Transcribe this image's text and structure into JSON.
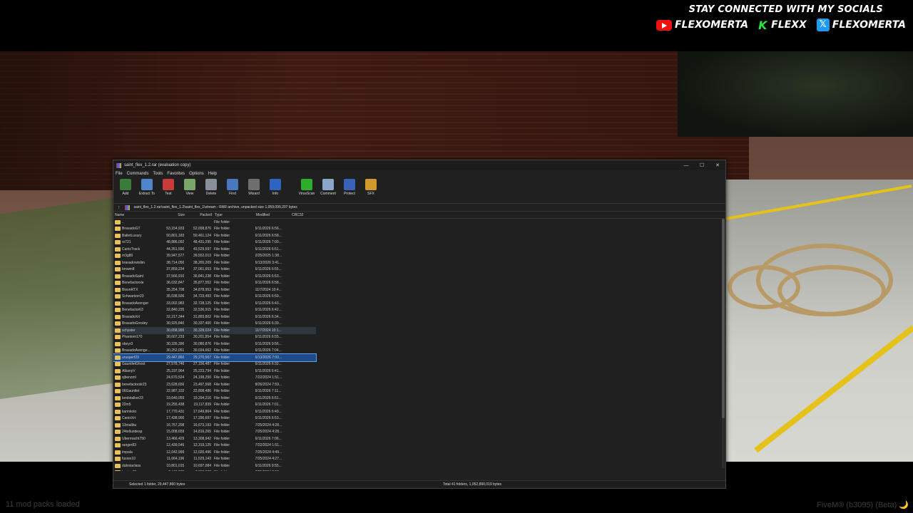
{
  "overlay": {
    "social_title": "STAY CONNECTED WITH MY SOCIALS",
    "socials": [
      {
        "icon": "youtube-icon",
        "label": "FLEXOMERTA"
      },
      {
        "icon": "kick-icon",
        "label": "FLEXX"
      },
      {
        "icon": "x-icon",
        "label": "FLEXOMERTA"
      }
    ]
  },
  "game": {
    "mods_loaded": "11 mod packs loaded",
    "fivem_version": "FiveM® (b3095) (Beta) 🌙"
  },
  "window": {
    "title": "saint_flex_1.2.rar (evaluation copy)",
    "minimize": "—",
    "maximize": "☐",
    "close": "✕",
    "menu": [
      "File",
      "Commands",
      "Tools",
      "Favorites",
      "Options",
      "Help"
    ],
    "toolbar": [
      {
        "label": "Add",
        "icon": "add-icon",
        "color": "#3a7a3a"
      },
      {
        "label": "Extract To",
        "icon": "extract-icon",
        "color": "#4f86c9"
      },
      {
        "label": "Test",
        "icon": "test-icon",
        "color": "#c93b3b"
      },
      {
        "label": "View",
        "icon": "view-icon",
        "color": "#7aa66a"
      },
      {
        "label": "Delete",
        "icon": "delete-icon",
        "color": "#8a8f99"
      },
      {
        "label": "Find",
        "icon": "find-icon",
        "color": "#4a78c0"
      },
      {
        "label": "Wizard",
        "icon": "wizard-icon",
        "color": "#6e6e6e"
      },
      {
        "label": "Info",
        "icon": "info-icon",
        "color": "#2f63c2"
      },
      {
        "label": "VirusScan",
        "icon": "virusscan-icon",
        "color": "#2cae2c"
      },
      {
        "label": "Comment",
        "icon": "comment-icon",
        "color": "#8aa6c8"
      },
      {
        "label": "Protect",
        "icon": "protect-icon",
        "color": "#3a62b8"
      },
      {
        "label": "SFX",
        "icon": "sfx-icon",
        "color": "#d09a2c"
      }
    ],
    "path": "saint_flex_1.2.rar\\saint_flex_1.2\\saint_flex_1\\stream - RAR archive, unpacked size 1,059,099,207 bytes",
    "columns": [
      "Name",
      "Size",
      "Packed",
      "Type",
      "Modified",
      "CRC32"
    ],
    "rows": [
      {
        "name": "..",
        "size": "",
        "packed": "",
        "type": "File folder",
        "modified": ""
      },
      {
        "name": "BravadoGT",
        "size": "53,154,933",
        "packed": "52,658,876",
        "type": "File folder",
        "modified": "6/11/2026 6:56..."
      },
      {
        "name": "BalletLuxury",
        "size": "50,801,183",
        "packed": "50,461,124",
        "type": "File folder",
        "modified": "6/11/2026 6:58..."
      },
      {
        "name": "rs721",
        "size": "48,886,092",
        "packed": "48,431,295",
        "type": "File folder",
        "modified": "6/11/2026 7:00..."
      },
      {
        "name": "CanisTrack",
        "size": "44,351,590",
        "packed": "43,529,597",
        "type": "File folder",
        "modified": "6/11/2026 6:51..."
      },
      {
        "name": "m3g80",
        "size": "39,947,577",
        "packed": "39,552,013",
        "type": "File folder",
        "modified": "2/25/2025 1:38..."
      },
      {
        "name": "bravadowtslim",
        "size": "38,714,050",
        "packed": "38,265,209",
        "type": "File folder",
        "modified": "6/13/2026 3:41..."
      },
      {
        "name": "bmwm8",
        "size": "37,859,234",
        "packed": "37,061,653",
        "type": "File folder",
        "modified": "6/11/2026 6:55..."
      },
      {
        "name": "BravadoSaint",
        "size": "37,566,910",
        "packed": "36,841,238",
        "type": "File folder",
        "modified": "6/11/2026 6:53..."
      },
      {
        "name": "Benefactorxle",
        "size": "36,032,847",
        "packed": "35,877,552",
        "type": "File folder",
        "modified": "6/11/2026 6:58..."
      },
      {
        "name": "BisonRTX",
        "size": "35,254,708",
        "packed": "34,878,953",
        "type": "File folder",
        "modified": "11/7/2024 10:4..."
      },
      {
        "name": "Schwartzer23",
        "size": "35,038,506",
        "packed": "34,723,493",
        "type": "File folder",
        "modified": "6/11/2026 6:59..."
      },
      {
        "name": "BravadoAvenger",
        "size": "33,002,983",
        "packed": "32,728,125",
        "type": "File folder",
        "modified": "6/11/2026 6:43..."
      },
      {
        "name": "Benefactor63",
        "size": "32,840,235",
        "packed": "32,536,915",
        "type": "File folder",
        "modified": "6/11/2026 6:42..."
      },
      {
        "name": "BravadoXrt",
        "size": "32,217,344",
        "packed": "31,893,802",
        "type": "File folder",
        "modified": "6/11/2026 6:34..."
      },
      {
        "name": "BravadoGresley",
        "size": "30,925,840",
        "packed": "30,337,400",
        "type": "File folder",
        "modified": "6/11/2026 6:39..."
      },
      {
        "name": "schyster",
        "size": "30,658,995",
        "packed": "30,328,024",
        "type": "File folder",
        "modified": "11/7/2024 10:1..."
      },
      {
        "name": "Phantom170",
        "size": "30,607,233",
        "packed": "30,201,854",
        "type": "File folder",
        "modified": "6/11/2026 6:55..."
      },
      {
        "name": "obeyr3",
        "size": "30,335,396",
        "packed": "30,080,876",
        "type": "File folder",
        "modified": "6/11/2026 9:56..."
      },
      {
        "name": "BravadoAvenge...",
        "size": "30,252,051",
        "packed": "30,034,662",
        "type": "File folder",
        "modified": "6/11/2026 7:04..."
      },
      {
        "name": "urusperf23",
        "size": "29,447,860",
        "packed": "29,270,907",
        "type": "File folder",
        "modified": "6/13/2026 7:00..."
      },
      {
        "name": "GauntletGhost",
        "size": "27,578,746",
        "packed": "27,156,487",
        "type": "File folder",
        "modified": "6/11/2026 6:32..."
      },
      {
        "name": "AlbanyV",
        "size": "25,197,964",
        "packed": "25,223,794",
        "type": "File folder",
        "modified": "6/11/2026 6:41..."
      },
      {
        "name": "sjbenzml",
        "size": "24,670,524",
        "packed": "24,199,250",
        "type": "File folder",
        "modified": "7/22/2024 1:51..."
      },
      {
        "name": "benefactorslr23",
        "size": "23,628,656",
        "packed": "23,497,568",
        "type": "File folder",
        "modified": "8/26/2024 7:59..."
      },
      {
        "name": "06Gauntlet",
        "size": "22,987,102",
        "packed": "22,808,486",
        "type": "File folder",
        "modified": "6/11/2026 7:11..."
      },
      {
        "name": "landstalker23",
        "size": "19,640,059",
        "packed": "19,294,216",
        "type": "File folder",
        "modified": "6/11/2026 6:51..."
      },
      {
        "name": "22m5",
        "size": "19,255,438",
        "packed": "19,117,839",
        "type": "File folder",
        "modified": "6/11/2026 7:01..."
      },
      {
        "name": "karinkoto",
        "size": "17,770,431",
        "packed": "17,649,864",
        "type": "File folder",
        "modified": "6/11/2026 6:49..."
      },
      {
        "name": "CanisXrt",
        "size": "17,438,900",
        "packed": "17,290,697",
        "type": "File folder",
        "modified": "6/11/2026 6:53..."
      },
      {
        "name": "13malibu",
        "size": "16,757,208",
        "packed": "16,673,193",
        "type": "File folder",
        "modified": "7/25/2024 4:28..."
      },
      {
        "name": "24telluridesp",
        "size": "15,008,659",
        "packed": "14,816,265",
        "type": "File folder",
        "modified": "7/25/2024 4:28..."
      },
      {
        "name": "Ubermacht750",
        "size": "13,466,429",
        "packed": "13,308,942",
        "type": "File folder",
        "modified": "6/11/2026 7:06..."
      },
      {
        "name": "ranger83",
        "size": "12,439,546",
        "packed": "12,319,125",
        "type": "File folder",
        "modified": "7/22/2024 1:51..."
      },
      {
        "name": "impala",
        "size": "12,042,999",
        "packed": "12,020,496",
        "type": "File folder",
        "modified": "7/25/2024 4:49..."
      },
      {
        "name": "fusion10",
        "size": "11,664,196",
        "packed": "11,529,143",
        "type": "File folder",
        "modified": "7/25/2024 4:27..."
      },
      {
        "name": "dubstaclass",
        "size": "10,801,015",
        "packed": "10,697,084",
        "type": "File folder",
        "modified": "6/11/2026 9:55..."
      },
      {
        "name": "lumina95",
        "size": "7,449,270",
        "packed": "7,362,970",
        "type": "File folder",
        "modified": "7/25/2024 2:50..."
      }
    ],
    "selected_row": "urusperf23",
    "hover_row": "schyster",
    "status_left": "Selected 1 folder, 29,447,860 bytes",
    "status_right": "Total 41 folders, 1,052,890,019 bytes"
  }
}
